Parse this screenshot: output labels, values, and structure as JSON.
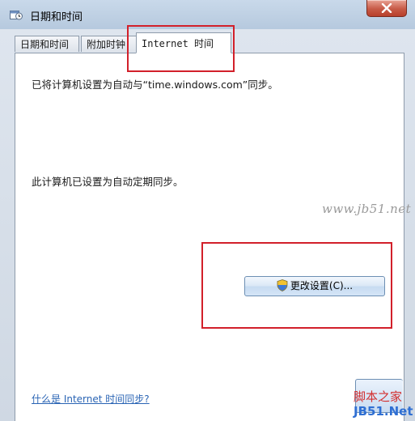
{
  "window": {
    "title": "日期和时间"
  },
  "tabs": [
    {
      "label": "日期和时间"
    },
    {
      "label": "附加时钟"
    },
    {
      "label": "Internet 时间",
      "active": true
    }
  ],
  "content": {
    "sync_message": "已将计算机设置为自动与“time.windows.com”同步。",
    "auto_message": "此计算机已设置为自动定期同步。",
    "change_button": "更改设置(C)...",
    "help_link": "什么是 Internet 时间同步?"
  },
  "watermarks": {
    "top": "www.jb51.net",
    "bottom_line1": "脚本之家",
    "bottom_line2": "JB51.Net"
  },
  "colors": {
    "highlight": "#d2202a",
    "link": "#2a64b4"
  }
}
